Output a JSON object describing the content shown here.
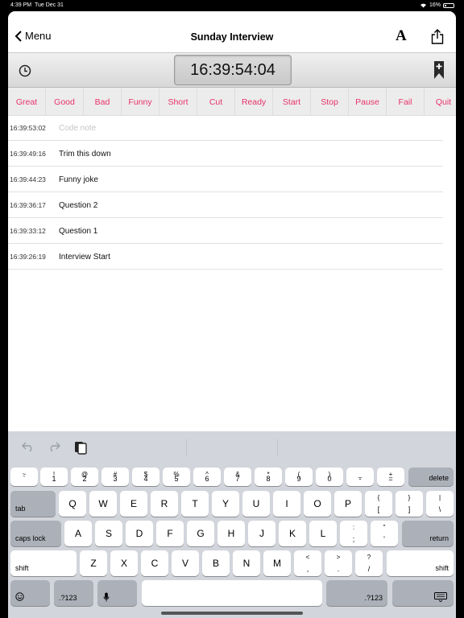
{
  "status_bar": {
    "time": "4:39 PM",
    "date": "Tue Dec 31",
    "battery": "16%"
  },
  "nav": {
    "back_label": "Menu",
    "title": "Sunday Interview"
  },
  "toolbar": {
    "timecode": "16:39:54:04"
  },
  "tags": [
    "Great",
    "Good",
    "Bad",
    "Funny",
    "Short",
    "Cut",
    "Ready",
    "Start",
    "Stop",
    "Pause",
    "Fail",
    "Quit"
  ],
  "notes": [
    {
      "time": "16:39:53:02",
      "text": "",
      "placeholder": "Code note"
    },
    {
      "time": "16:39:49:16",
      "text": "Trim this down"
    },
    {
      "time": "16:39:44:23",
      "text": "Funny joke"
    },
    {
      "time": "16:39:36:17",
      "text": "Question 2"
    },
    {
      "time": "16:39:33:12",
      "text": "Question 1"
    },
    {
      "time": "16:39:26:19",
      "text": "Interview Start"
    }
  ],
  "keyboard": {
    "row1": [
      {
        "top": "~",
        "bot": "`"
      },
      {
        "top": "!",
        "bot": "1"
      },
      {
        "top": "@",
        "bot": "2"
      },
      {
        "top": "#",
        "bot": "3"
      },
      {
        "top": "$",
        "bot": "4"
      },
      {
        "top": "%",
        "bot": "5"
      },
      {
        "top": "^",
        "bot": "6"
      },
      {
        "top": "&",
        "bot": "7"
      },
      {
        "top": "*",
        "bot": "8"
      },
      {
        "top": "(",
        "bot": "9"
      },
      {
        "top": ")",
        "bot": "0"
      },
      {
        "top": "_",
        "bot": "-"
      },
      {
        "top": "+",
        "bot": "="
      }
    ],
    "delete": "delete",
    "tab": "tab",
    "row2": [
      "Q",
      "W",
      "E",
      "R",
      "T",
      "Y",
      "U",
      "I",
      "O",
      "P"
    ],
    "row2_extra": [
      {
        "top": "{",
        "bot": "["
      },
      {
        "top": "}",
        "bot": "]"
      },
      {
        "top": "|",
        "bot": "\\"
      }
    ],
    "caps": "caps lock",
    "row3": [
      "A",
      "S",
      "D",
      "F",
      "G",
      "H",
      "J",
      "K",
      "L"
    ],
    "row3_extra": [
      {
        "top": ":",
        "bot": ";"
      },
      {
        "top": "\"",
        "bot": "'"
      }
    ],
    "return": "return",
    "shift": "shift",
    "row4": [
      "Z",
      "X",
      "C",
      "V",
      "B",
      "N",
      "M"
    ],
    "row4_extra": [
      {
        "top": "<",
        "bot": ","
      },
      {
        "top": ">",
        "bot": "."
      },
      {
        "top": "?",
        "bot": "/"
      }
    ],
    "numbers": ".?123"
  },
  "colors": {
    "tag_text": "#e8326a",
    "keyboard_bg": "#d2d5db"
  }
}
